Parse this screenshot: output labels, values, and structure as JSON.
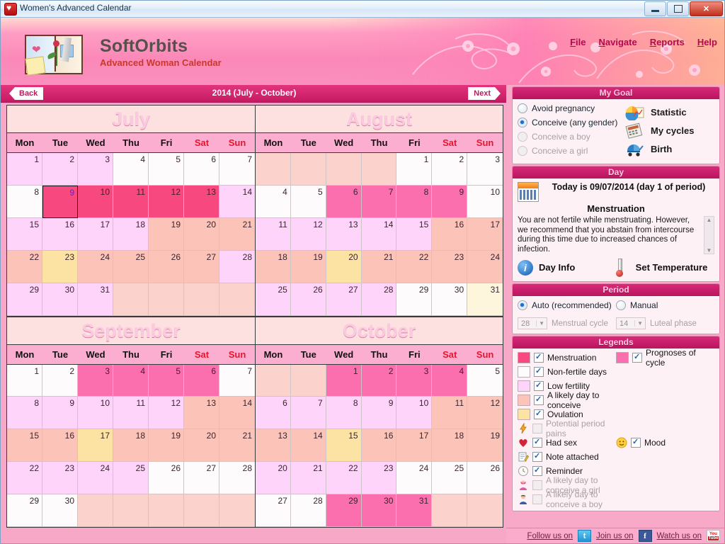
{
  "window": {
    "title": "Women's Advanced Calendar",
    "icon": "heart-icon",
    "minimize_label": "Minimize",
    "maximize_label": "Restore",
    "close_label": "✕"
  },
  "banner": {
    "brand": "SoftOrbits",
    "tagline": "Advanced Woman Calendar",
    "menu": [
      {
        "pre": "F",
        "rest": "ile"
      },
      {
        "pre": "N",
        "rest": "avigate"
      },
      {
        "pre": "R",
        "rest": "eports"
      },
      {
        "pre": "H",
        "rest": "elp"
      }
    ]
  },
  "nav": {
    "back": "Back",
    "next": "Next",
    "range_title": "2014 (July - October)"
  },
  "calendar": {
    "weekdays": [
      "Mon",
      "Tue",
      "Wed",
      "Thu",
      "Fri",
      "Sat",
      "Sun"
    ],
    "colors": {
      "menstruation": "#f7497f",
      "prognoses": "#fb6fae",
      "non_fertile": "#fdfbfb",
      "low_fertility": "#ffd4fb",
      "likely_conceive": "#fcc3b8",
      "ovulation": "#fce3a4",
      "outside": "#fbd2cc",
      "selected_text": "#6a21d0"
    },
    "months": [
      {
        "name": "July",
        "lead_blank": 0,
        "trail_blank": 4,
        "days": [
          {
            "n": 1,
            "t": "low_fertility"
          },
          {
            "n": 2,
            "t": "low_fertility"
          },
          {
            "n": 3,
            "t": "low_fertility"
          },
          {
            "n": 4,
            "t": "non_fertile"
          },
          {
            "n": 5,
            "t": "non_fertile"
          },
          {
            "n": 6,
            "t": "non_fertile"
          },
          {
            "n": 7,
            "t": "non_fertile"
          },
          {
            "n": 8,
            "t": "non_fertile"
          },
          {
            "n": 9,
            "t": "menstruation",
            "sel": true
          },
          {
            "n": 10,
            "t": "menstruation"
          },
          {
            "n": 11,
            "t": "menstruation"
          },
          {
            "n": 12,
            "t": "menstruation"
          },
          {
            "n": 13,
            "t": "menstruation"
          },
          {
            "n": 14,
            "t": "low_fertility"
          },
          {
            "n": 15,
            "t": "low_fertility"
          },
          {
            "n": 16,
            "t": "low_fertility"
          },
          {
            "n": 17,
            "t": "low_fertility"
          },
          {
            "n": 18,
            "t": "low_fertility"
          },
          {
            "n": 19,
            "t": "likely_conceive"
          },
          {
            "n": 20,
            "t": "likely_conceive"
          },
          {
            "n": 21,
            "t": "likely_conceive"
          },
          {
            "n": 22,
            "t": "likely_conceive"
          },
          {
            "n": 23,
            "t": "ovulation"
          },
          {
            "n": 24,
            "t": "likely_conceive"
          },
          {
            "n": 25,
            "t": "likely_conceive"
          },
          {
            "n": 26,
            "t": "likely_conceive"
          },
          {
            "n": 27,
            "t": "likely_conceive"
          },
          {
            "n": 28,
            "t": "low_fertility"
          },
          {
            "n": 29,
            "t": "low_fertility"
          },
          {
            "n": 30,
            "t": "low_fertility"
          },
          {
            "n": 31,
            "t": "low_fertility"
          }
        ]
      },
      {
        "name": "August",
        "lead_blank": 4,
        "trail_blank": 0,
        "days": [
          {
            "n": 1,
            "t": "non_fertile"
          },
          {
            "n": 2,
            "t": "non_fertile"
          },
          {
            "n": 3,
            "t": "non_fertile"
          },
          {
            "n": 4,
            "t": "non_fertile"
          },
          {
            "n": 5,
            "t": "non_fertile"
          },
          {
            "n": 6,
            "t": "prognoses"
          },
          {
            "n": 7,
            "t": "prognoses"
          },
          {
            "n": 8,
            "t": "prognoses"
          },
          {
            "n": 9,
            "t": "prognoses"
          },
          {
            "n": 10,
            "t": "non_fertile"
          },
          {
            "n": 11,
            "t": "low_fertility"
          },
          {
            "n": 12,
            "t": "low_fertility"
          },
          {
            "n": 13,
            "t": "low_fertility"
          },
          {
            "n": 14,
            "t": "low_fertility"
          },
          {
            "n": 15,
            "t": "low_fertility"
          },
          {
            "n": 16,
            "t": "likely_conceive"
          },
          {
            "n": 17,
            "t": "likely_conceive"
          },
          {
            "n": 18,
            "t": "likely_conceive"
          },
          {
            "n": 19,
            "t": "likely_conceive"
          },
          {
            "n": 20,
            "t": "ovulation"
          },
          {
            "n": 21,
            "t": "likely_conceive"
          },
          {
            "n": 22,
            "t": "likely_conceive"
          },
          {
            "n": 23,
            "t": "likely_conceive"
          },
          {
            "n": 24,
            "t": "likely_conceive"
          },
          {
            "n": 25,
            "t": "low_fertility"
          },
          {
            "n": 26,
            "t": "low_fertility"
          },
          {
            "n": 27,
            "t": "low_fertility"
          },
          {
            "n": 28,
            "t": "low_fertility"
          },
          {
            "n": 29,
            "t": "non_fertile"
          },
          {
            "n": 30,
            "t": "non_fertile"
          },
          {
            "n": 31,
            "t": "ovulation_light"
          }
        ]
      },
      {
        "name": "September",
        "lead_blank": 0,
        "trail_blank": 5,
        "days": [
          {
            "n": 1,
            "t": "non_fertile"
          },
          {
            "n": 2,
            "t": "non_fertile"
          },
          {
            "n": 3,
            "t": "prognoses"
          },
          {
            "n": 4,
            "t": "prognoses"
          },
          {
            "n": 5,
            "t": "prognoses"
          },
          {
            "n": 6,
            "t": "prognoses"
          },
          {
            "n": 7,
            "t": "non_fertile"
          },
          {
            "n": 8,
            "t": "low_fertility"
          },
          {
            "n": 9,
            "t": "low_fertility"
          },
          {
            "n": 10,
            "t": "low_fertility"
          },
          {
            "n": 11,
            "t": "low_fertility"
          },
          {
            "n": 12,
            "t": "low_fertility"
          },
          {
            "n": 13,
            "t": "likely_conceive"
          },
          {
            "n": 14,
            "t": "likely_conceive"
          },
          {
            "n": 15,
            "t": "likely_conceive"
          },
          {
            "n": 16,
            "t": "likely_conceive"
          },
          {
            "n": 17,
            "t": "ovulation"
          },
          {
            "n": 18,
            "t": "likely_conceive"
          },
          {
            "n": 19,
            "t": "likely_conceive"
          },
          {
            "n": 20,
            "t": "likely_conceive"
          },
          {
            "n": 21,
            "t": "likely_conceive"
          },
          {
            "n": 22,
            "t": "low_fertility"
          },
          {
            "n": 23,
            "t": "low_fertility"
          },
          {
            "n": 24,
            "t": "low_fertility"
          },
          {
            "n": 25,
            "t": "low_fertility"
          },
          {
            "n": 26,
            "t": "non_fertile"
          },
          {
            "n": 27,
            "t": "non_fertile"
          },
          {
            "n": 28,
            "t": "non_fertile"
          },
          {
            "n": 29,
            "t": "non_fertile"
          },
          {
            "n": 30,
            "t": "non_fertile"
          }
        ]
      },
      {
        "name": "October",
        "lead_blank": 2,
        "trail_blank": 2,
        "days": [
          {
            "n": 1,
            "t": "prognoses"
          },
          {
            "n": 2,
            "t": "prognoses"
          },
          {
            "n": 3,
            "t": "prognoses"
          },
          {
            "n": 4,
            "t": "prognoses"
          },
          {
            "n": 5,
            "t": "non_fertile"
          },
          {
            "n": 6,
            "t": "low_fertility"
          },
          {
            "n": 7,
            "t": "low_fertility"
          },
          {
            "n": 8,
            "t": "low_fertility"
          },
          {
            "n": 9,
            "t": "low_fertility"
          },
          {
            "n": 10,
            "t": "low_fertility"
          },
          {
            "n": 11,
            "t": "likely_conceive"
          },
          {
            "n": 12,
            "t": "likely_conceive"
          },
          {
            "n": 13,
            "t": "likely_conceive"
          },
          {
            "n": 14,
            "t": "likely_conceive"
          },
          {
            "n": 15,
            "t": "ovulation"
          },
          {
            "n": 16,
            "t": "likely_conceive"
          },
          {
            "n": 17,
            "t": "likely_conceive"
          },
          {
            "n": 18,
            "t": "likely_conceive"
          },
          {
            "n": 19,
            "t": "likely_conceive"
          },
          {
            "n": 20,
            "t": "low_fertility"
          },
          {
            "n": 21,
            "t": "low_fertility"
          },
          {
            "n": 22,
            "t": "low_fertility"
          },
          {
            "n": 23,
            "t": "low_fertility"
          },
          {
            "n": 24,
            "t": "non_fertile"
          },
          {
            "n": 25,
            "t": "non_fertile"
          },
          {
            "n": 26,
            "t": "non_fertile"
          },
          {
            "n": 27,
            "t": "non_fertile"
          },
          {
            "n": 28,
            "t": "non_fertile"
          },
          {
            "n": 29,
            "t": "prognoses"
          },
          {
            "n": 30,
            "t": "prognoses"
          },
          {
            "n": 31,
            "t": "prognoses"
          }
        ]
      }
    ]
  },
  "my_goal": {
    "title": "My Goal",
    "options": [
      {
        "label": "Avoid pregnancy",
        "selected": false,
        "disabled": false
      },
      {
        "label": "Conceive (any gender)",
        "selected": true,
        "disabled": false
      },
      {
        "label": "Conceive a boy",
        "selected": false,
        "disabled": true
      },
      {
        "label": "Conceive a girl",
        "selected": false,
        "disabled": true
      }
    ],
    "links": [
      {
        "label": "Statistic",
        "icon": "pie-chart-icon"
      },
      {
        "label": "My cycles",
        "icon": "calculator-icon"
      },
      {
        "label": "Birth",
        "icon": "stroller-icon"
      }
    ]
  },
  "day_panel": {
    "title": "Day",
    "icon": "calendar-icon",
    "today_text": "Today is 09/07/2014 (day 1 of period)",
    "phase": "Menstruation",
    "description": "You are not fertile while menstruating. However, we recommend that you abstain from intercourse during this time due to increased chances of infection.",
    "buttons": [
      {
        "label": "Day Info",
        "icon": "info-icon"
      },
      {
        "label": "Set Temperature",
        "icon": "thermometer-icon"
      }
    ]
  },
  "period": {
    "title": "Period",
    "auto_label": "Auto (recommended)",
    "auto_selected": true,
    "manual_label": "Manual",
    "manual_selected": false,
    "menstrual_cycle_value": "28",
    "menstrual_cycle_label": "Menstrual cycle",
    "luteal_phase_value": "14",
    "luteal_phase_label": "Luteal phase"
  },
  "legends": {
    "title": "Legends",
    "left": [
      {
        "label": "Menstruation",
        "swatch": "#f7497f",
        "checked": true,
        "kind": "swatch",
        "dim": false
      },
      {
        "label": "Non-fertile days",
        "swatch": "#fdfbfb",
        "checked": true,
        "kind": "swatch",
        "dim": false
      },
      {
        "label": "Low fertility",
        "swatch": "#ffd4fb",
        "checked": true,
        "kind": "swatch",
        "dim": false
      },
      {
        "label": "A likely day to conceive",
        "swatch": "#fcc3b8",
        "checked": true,
        "kind": "swatch",
        "dim": false
      },
      {
        "label": "Ovulation",
        "swatch": "#fce3a4",
        "checked": true,
        "kind": "swatch",
        "dim": false
      },
      {
        "label": "Potential period pains",
        "icon": "lightning-icon",
        "checked": false,
        "kind": "icon",
        "dim": true
      },
      {
        "label": "Had sex",
        "icon": "heart-icon",
        "checked": true,
        "kind": "icon",
        "dim": false
      },
      {
        "label": "Note attached",
        "icon": "note-icon",
        "checked": true,
        "kind": "icon",
        "dim": false
      },
      {
        "label": "Reminder",
        "icon": "clock-icon",
        "checked": true,
        "kind": "icon",
        "dim": false
      },
      {
        "label": "A likely day to conceive a girl",
        "icon": "girl-icon",
        "checked": false,
        "kind": "icon",
        "dim": true
      },
      {
        "label": "A likely day to conceive a boy",
        "icon": "boy-icon",
        "checked": false,
        "kind": "icon",
        "dim": true
      }
    ],
    "right": [
      {
        "label": "Prognoses of cycle",
        "swatch": "#fb6fae",
        "checked": true,
        "kind": "swatch",
        "dim": false,
        "row": 0
      },
      {
        "label": "Mood",
        "icon": "smiley-icon",
        "checked": true,
        "kind": "icon",
        "dim": false,
        "row": 6
      }
    ]
  },
  "social": [
    {
      "label": "Follow us on",
      "icon": "twitter-icon"
    },
    {
      "label": "Join us on",
      "icon": "facebook-icon"
    },
    {
      "label": "Watch us on",
      "icon": "youtube-icon"
    }
  ]
}
